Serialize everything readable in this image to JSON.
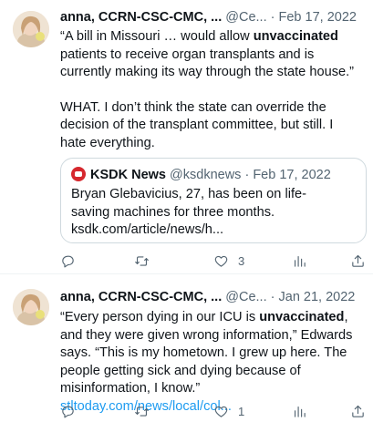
{
  "tweets": [
    {
      "author_name": "anna, CCRN-CSC-CMC, ...",
      "author_handle": "@Ce...",
      "separator": "·",
      "date": "Feb 17, 2022",
      "text_p1_before": "“A bill in Missouri … would allow ",
      "text_p1_bold": "unvaccinated",
      "text_p1_after": " patients to receive organ transplants and is currently making its way through the state house.”",
      "text_p2": "WHAT. I don’t think the state can override the decision of the transplant committee, but still. I hate everything.",
      "quote": {
        "name": "KSDK News",
        "handle": "@ksdknews",
        "separator": "·",
        "date": "Feb 17, 2022",
        "text": "Bryan Glebavicius, 27, has been on life-saving machines for three months.",
        "link": "ksdk.com/article/news/h..."
      },
      "actions": {
        "reply_count": "",
        "retweet_count": "",
        "like_count": "3",
        "views_count": ""
      }
    },
    {
      "author_name": "anna, CCRN-CSC-CMC, ...",
      "author_handle": "@Ce...",
      "separator": "·",
      "date": "Jan 21, 2022",
      "text_before": "“Every person dying in our ICU is ",
      "text_bold": "unvaccinated",
      "text_after": ", and they were given wrong information,” Edwards says. “This is my hometown. I grew up here. The people getting sick and dying because of misinformation, I know.” ",
      "link": "stltoday.com/news/local/col...",
      "actions": {
        "reply_count": "",
        "retweet_count": "",
        "like_count": "1",
        "views_count": ""
      }
    }
  ],
  "icons": {
    "menu": "more-dots-icon",
    "reply": "reply-icon",
    "retweet": "retweet-icon",
    "like": "heart-icon",
    "views": "views-bar-chart-icon",
    "share": "share-upload-icon"
  },
  "colors": {
    "text_primary": "#0f1419",
    "text_secondary": "#536471",
    "link": "#1d9bf0",
    "border": "#cfd9de",
    "divider": "#eff3f4",
    "ksdk_logo": "#d6282e"
  }
}
